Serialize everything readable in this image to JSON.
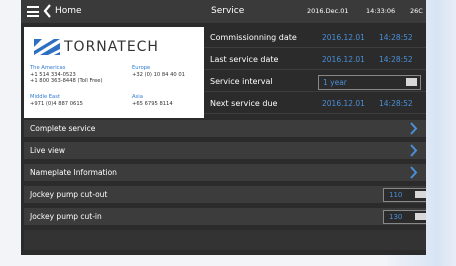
{
  "header": {
    "home_label": "Home",
    "title": "Service",
    "date": "2016.Dec.01",
    "time": "14:33:06",
    "temperature": "26C"
  },
  "logo": {
    "brand": "TORNATECH",
    "contacts": [
      {
        "region": "The Americas",
        "phones": [
          "+1 514 334-0523",
          "+1 800 363-8448 (Toll Free)"
        ]
      },
      {
        "region": "Europe",
        "phones": [
          "+32 (0) 10 84 40 01"
        ]
      },
      {
        "region": "Middle East",
        "phones": [
          "+971 (0)4 887 0615"
        ]
      },
      {
        "region": "Asia",
        "phones": [
          "+65 6795 8114"
        ]
      }
    ]
  },
  "info": {
    "commissioning": {
      "label": "Commissionning date",
      "date": "2016.12.01",
      "time": "14:28:52"
    },
    "last_service": {
      "label": "Last service date",
      "date": "2016.12.01",
      "time": "14:28:52"
    },
    "interval": {
      "label": "Service interval",
      "value": "1 year"
    },
    "next_due": {
      "label": "Next service due",
      "date": "2016.12.01",
      "time": "14:28:52"
    }
  },
  "menu": {
    "complete_service": "Complete service",
    "live_view": "Live view",
    "nameplate": "Nameplate Information",
    "cut_out": {
      "label": "Jockey pump cut-out",
      "value": "110"
    },
    "cut_in": {
      "label": "Jockey pump cut-in",
      "value": "130"
    }
  },
  "colors": {
    "accent": "#4a8fd8",
    "panel": "#2b2b2b",
    "row": "#3c3c3c"
  }
}
